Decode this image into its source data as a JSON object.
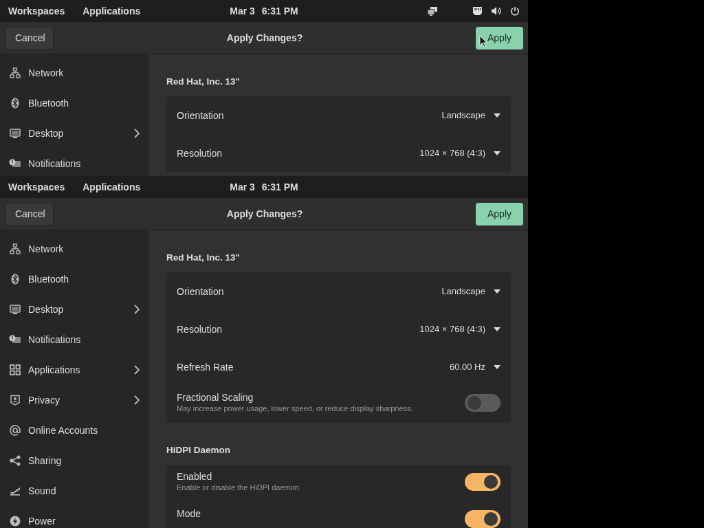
{
  "screens": [
    {
      "top_bar": {
        "workspaces": "Workspaces",
        "applications": "Applications",
        "date": "Mar 3",
        "time": "6:31 PM",
        "tray": [
          {
            "kind": "displays"
          },
          {
            "kind": "network"
          },
          {
            "kind": "volume"
          },
          {
            "kind": "power"
          }
        ]
      },
      "header": {
        "cancel": "Cancel",
        "title": "Apply Changes?",
        "apply": "Apply",
        "pointer": true
      },
      "sidebar": [
        {
          "label": "Network",
          "expandable": false
        },
        {
          "label": "Bluetooth",
          "expandable": false
        },
        {
          "label": "Desktop",
          "expandable": true
        },
        {
          "label": "Notifications",
          "expandable": false
        }
      ],
      "sections": [
        {
          "title": "Red Hat, Inc. 13\"",
          "rows": [
            {
              "kind": "dropdown",
              "label": "Orientation",
              "value": "Landscape"
            },
            {
              "kind": "dropdown",
              "label": "Resolution",
              "value": "1024 × 768 (4:3)"
            }
          ]
        }
      ]
    },
    {
      "top_bar": {
        "workspaces": "Workspaces",
        "applications": "Applications",
        "date": "Mar 3",
        "time": "6:31 PM"
      },
      "header": {
        "cancel": "Cancel",
        "title": "Apply Changes?",
        "apply": "Apply",
        "pointer": false
      },
      "sidebar": [
        {
          "label": "Network",
          "expandable": false
        },
        {
          "label": "Bluetooth",
          "expandable": false
        },
        {
          "label": "Desktop",
          "expandable": true
        },
        {
          "label": "Notifications",
          "expandable": false
        },
        {
          "label": "Applications",
          "expandable": true
        },
        {
          "label": "Privacy",
          "expandable": true
        },
        {
          "label": "Online Accounts",
          "expandable": false
        },
        {
          "label": "Sharing",
          "expandable": false
        },
        {
          "label": "Sound",
          "expandable": false
        },
        {
          "label": "Power",
          "expandable": false
        }
      ],
      "sections": [
        {
          "title": "Red Hat, Inc. 13\"",
          "rows": [
            {
              "kind": "dropdown",
              "label": "Orientation",
              "value": "Landscape"
            },
            {
              "kind": "dropdown",
              "label": "Resolution",
              "value": "1024 × 768 (4:3)"
            },
            {
              "kind": "dropdown",
              "label": "Refresh Rate",
              "value": "60.00 Hz"
            },
            {
              "kind": "toggle",
              "label": "Fractional Scaling",
              "subtitle": "May increase power usage, lower speed, or reduce display sharpness.",
              "on": false
            }
          ]
        },
        {
          "title": "HiDPI Daemon",
          "rows": [
            {
              "kind": "toggle",
              "label": "Enabled",
              "subtitle": "Enable or disable the HiDPI daemon.",
              "on": true
            },
            {
              "kind": "toggle",
              "label": "Mode",
              "on": true
            }
          ]
        }
      ]
    }
  ]
}
